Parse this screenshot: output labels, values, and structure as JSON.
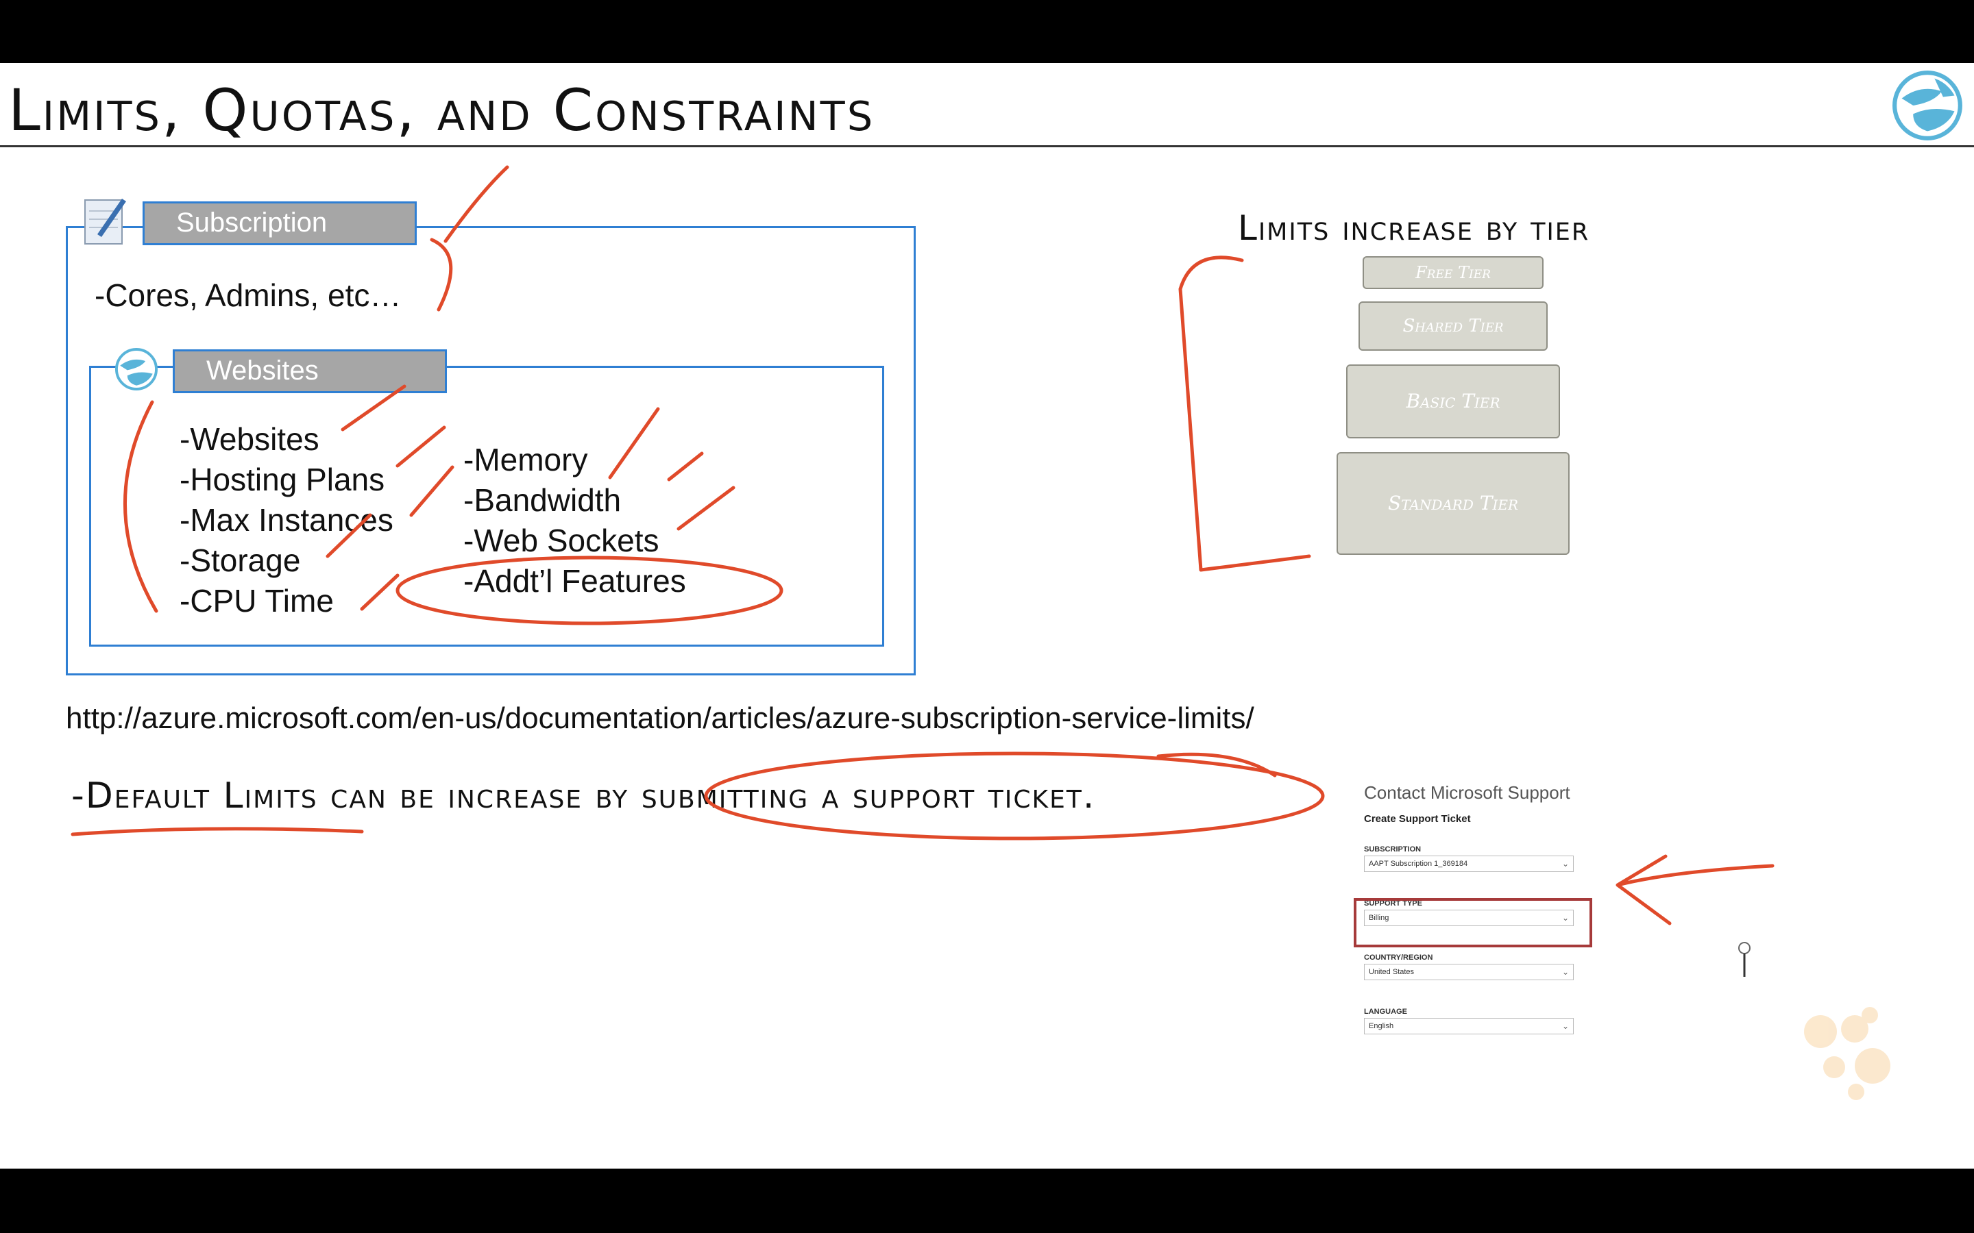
{
  "slide": {
    "title": "Limits, Quotas, and Constraints"
  },
  "diagram": {
    "subscription_label": "Subscription",
    "subscription_note": "-Cores, Admins, etc…",
    "websites_label": "Websites",
    "websites_col1": [
      "-Websites",
      "-Hosting Plans",
      "-Max Instances",
      "-Storage",
      "-CPU Time"
    ],
    "websites_col2": [
      "-Memory",
      "-Bandwidth",
      "-Web Sockets",
      "-Addt’l Features"
    ]
  },
  "tiers": {
    "heading": "Limits increase by tier",
    "items": [
      "Free Tier",
      "Shared Tier",
      "Basic Tier",
      "Standard Tier"
    ]
  },
  "url": "http://azure.microsoft.com/en-us/documentation/articles/azure-subscription-service-limits/",
  "note": "-Default Limits can be increase by submitting a support ticket.",
  "support_form": {
    "title": "Contact Microsoft Support",
    "subtitle": "Create Support Ticket",
    "fields": [
      {
        "label": "SUBSCRIPTION",
        "value": "AAPT Subscription 1_369184"
      },
      {
        "label": "SUPPORT TYPE",
        "value": "Billing"
      },
      {
        "label": "COUNTRY/REGION",
        "value": "United States"
      },
      {
        "label": "LANGUAGE",
        "value": "English"
      }
    ]
  },
  "colors": {
    "accent_blue": "#2f7fd3",
    "ink_red": "#e04a2a",
    "highlight_red": "#a63a3a"
  }
}
